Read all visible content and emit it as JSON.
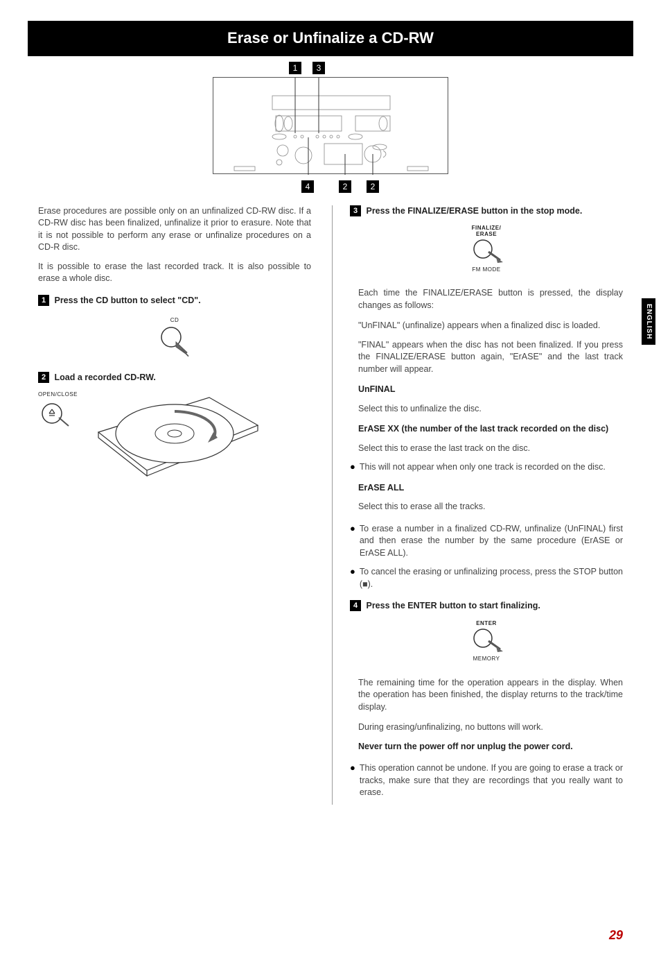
{
  "page": {
    "title": "Erase or Unfinalize a CD-RW",
    "side_tab": "ENGLISH",
    "page_number": "29"
  },
  "callouts": {
    "c1": "1",
    "c2": "2",
    "c3": "3",
    "c4": "4"
  },
  "intro": {
    "p1": "Erase procedures are possible only on an unfinalized CD-RW disc. If a CD-RW disc has been finalized, unfinalize it prior to erasure. Note that it is not possible to perform any erase or unfinalize procedures on a CD-R disc.",
    "p2": "It is possible to erase the last recorded track. It is also possible to erase a whole disc."
  },
  "steps": {
    "s1": {
      "num": "1",
      "title": "Press the CD button to select \"CD\".",
      "btn_label": "CD"
    },
    "s2": {
      "num": "2",
      "title": "Load a recorded CD-RW.",
      "btn_label": "OPEN/CLOSE"
    },
    "s3": {
      "num": "3",
      "title": "Press the FINALIZE/ERASE button in the stop mode.",
      "btn_top": "FINALIZE/",
      "btn_top2": "ERASE",
      "btn_bottom": "FM MODE",
      "p1": "Each time the FINALIZE/ERASE button is pressed, the display changes as follows:",
      "p2": "\"UnFINAL\" (unfinalize) appears when a finalized disc is loaded.",
      "p3": "\"FINAL\" appears when the disc has not been finalized. If you press the FINALIZE/ERASE button again, \"ErASE\" and the last track number will appear.",
      "opt1_title": "UnFINAL",
      "opt1_desc": "Select this to unfinalize the disc.",
      "opt2_title": "ErASE XX (the number of the last track recorded on the disc)",
      "opt2_desc": "Select this to erase the last track on the disc.",
      "opt2_bullet": "This will not appear when only one track is recorded on the disc.",
      "opt3_title": "ErASE ALL",
      "opt3_desc": "Select this to erase all the tracks.",
      "bullet1": "To erase a number in a finalized CD-RW, unfinalize (UnFINAL) first and then erase the number by the same procedure (ErASE or ErASE ALL).",
      "bullet2": "To cancel the erasing or unfinalizing process, press the STOP button (■)."
    },
    "s4": {
      "num": "4",
      "title": "Press the ENTER button to start finalizing.",
      "btn_top": "ENTER",
      "btn_bottom": "MEMORY",
      "p1": "The remaining time for the operation appears in the display. When the operation has been finished, the display returns to the track/time display.",
      "p2": "During erasing/unfinalizing, no buttons will work.",
      "warn": "Never turn the power off nor unplug the power cord.",
      "bullet": "This operation cannot be undone. If you are going to erase a track or tracks, make sure that they are recordings that you really want to erase."
    }
  }
}
